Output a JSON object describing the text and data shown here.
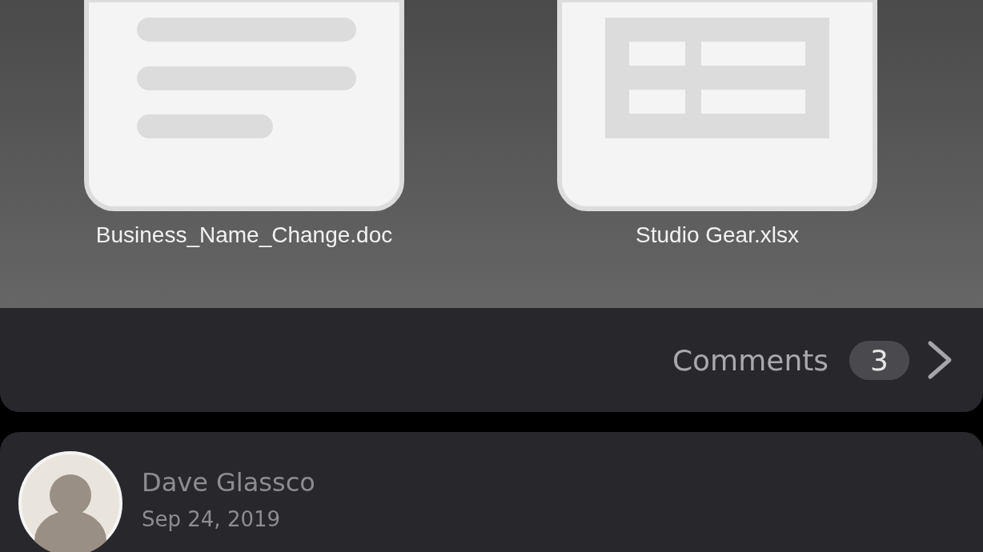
{
  "files": [
    {
      "name": "Business_Name_Change.doc",
      "kind": "document"
    },
    {
      "name": "Studio Gear.xlsx",
      "kind": "spreadsheet"
    }
  ],
  "comments": {
    "label": "Comments",
    "count": "3"
  },
  "post": {
    "author": "Dave Glassco",
    "date": "Sep 24, 2019"
  }
}
